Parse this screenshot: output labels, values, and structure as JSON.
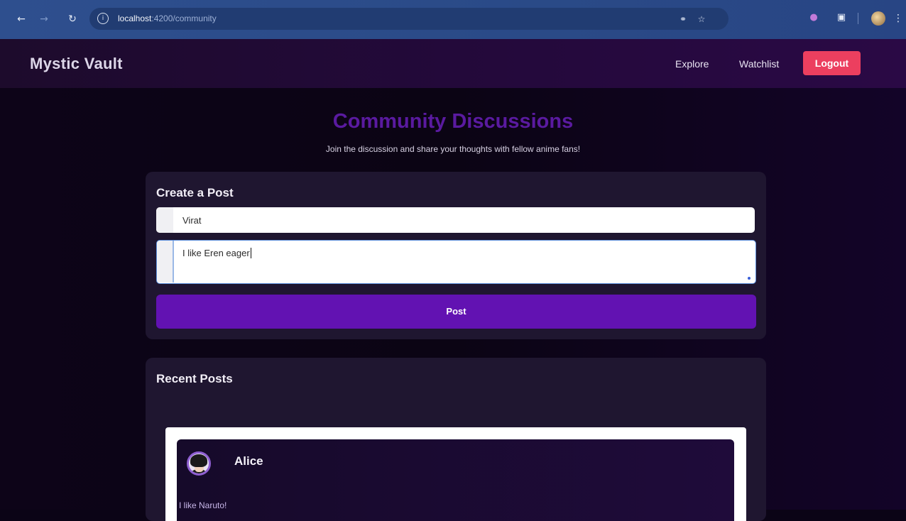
{
  "browser": {
    "url_host": "localhost",
    "url_path": ":4200/community"
  },
  "header": {
    "brand": "Mystic Vault",
    "nav": [
      "Explore",
      "Watchlist"
    ],
    "logout_label": "Logout"
  },
  "page": {
    "title": "Community Discussions",
    "subtitle": "Join the discussion and share your thoughts with fellow anime fans!"
  },
  "create_post": {
    "title": "Create a Post",
    "name_value": "Virat",
    "message_value": "I like Eren eager",
    "post_label": "Post"
  },
  "recent_posts": {
    "title": "Recent Posts",
    "posts": [
      {
        "author": "Alice",
        "text": "I like Naruto!"
      }
    ]
  },
  "colors": {
    "accent": "#6212b2",
    "title": "#5a1aa0",
    "logout": "#ec3f5f"
  }
}
